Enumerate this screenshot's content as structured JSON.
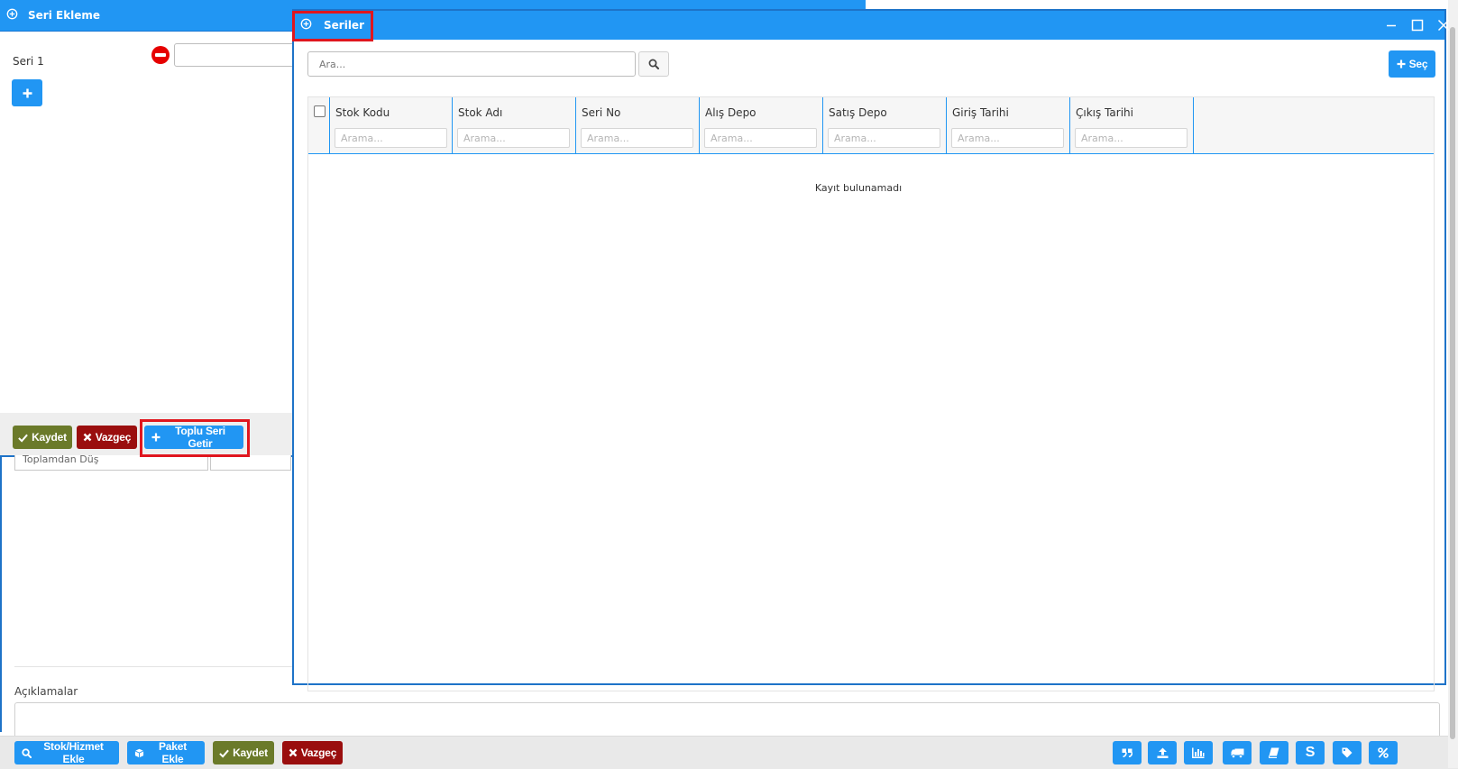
{
  "main_form": {
    "row_input_text": "Toplamdan Düş",
    "aciklamalar_label": "Açıklamalar",
    "footer": {
      "stok_hizmet_label": "Stok/Hizmet Ekle",
      "paket_label": "Paket Ekle",
      "kaydet_label": "Kaydet",
      "vazgec_label": "Vazgeç",
      "s_label": "S"
    }
  },
  "seri_ekleme": {
    "title": "Seri Ekleme",
    "seri1_label": "Seri 1",
    "footer": {
      "kaydet_label": "Kaydet",
      "vazgec_label": "Vazgeç",
      "toplu_label": "Toplu Seri Getir"
    }
  },
  "seriler": {
    "title": "Seriler",
    "search_placeholder": "Ara...",
    "sec_label": "Seç",
    "filter_placeholder": "Arama...",
    "columns": [
      {
        "label": "Stok Kodu"
      },
      {
        "label": "Stok Adı"
      },
      {
        "label": "Seri No"
      },
      {
        "label": "Alış Depo"
      },
      {
        "label": "Satış Depo"
      },
      {
        "label": "Giriş Tarihi"
      },
      {
        "label": "Çıkış Tarihi"
      }
    ],
    "empty_message": "Kayıt bulunamadı"
  },
  "colors": {
    "primary": "#2196f3",
    "success": "#6b7a2a",
    "danger": "#9a0e0e",
    "highlight": "#e0161e",
    "remove": "#e60000"
  }
}
